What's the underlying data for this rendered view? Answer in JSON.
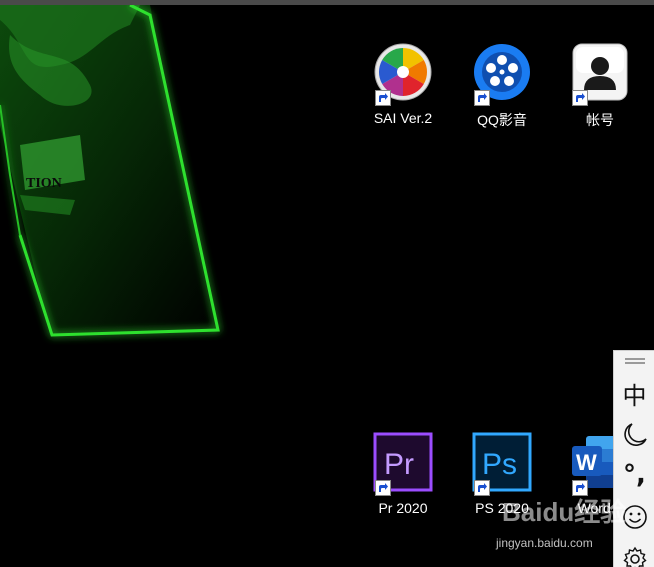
{
  "desktop": {
    "icons": [
      {
        "id": "sai",
        "label": "SAI Ver.2",
        "icon": "sai-color-wheel-icon"
      },
      {
        "id": "qq",
        "label": "QQ影音",
        "icon": "qq-player-icon"
      },
      {
        "id": "acct",
        "label": "帐号",
        "icon": "user-account-icon"
      },
      {
        "id": "pr",
        "label": "Pr 2020",
        "icon": "premiere-pro-icon"
      },
      {
        "id": "ps",
        "label": "PS 2020",
        "icon": "photoshop-icon"
      },
      {
        "id": "word",
        "label": "Word 2",
        "icon": "word-icon"
      }
    ]
  },
  "ime_toolbar": {
    "language": "中",
    "punctuation": "°,",
    "buttons": [
      "drag-handle-icon",
      "language-toggle",
      "moon-icon",
      "punctuation-toggle",
      "emoji-icon",
      "gear-icon"
    ]
  },
  "watermark": {
    "brand": "Baidu经验",
    "url": "jingyan.baidu.com"
  },
  "colors": {
    "desktop_bg": "#000000",
    "wallpaper_green": "#1fd11f",
    "pr_purple": "#9b4dff",
    "ps_blue": "#31a8ff",
    "word_blue": "#185abd",
    "qq_blue": "#1a7cf2"
  }
}
